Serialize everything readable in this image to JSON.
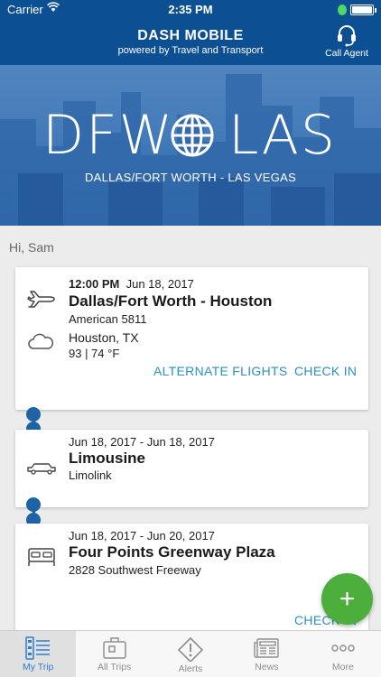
{
  "status_bar": {
    "carrier": "Carrier",
    "time": "2:35 PM"
  },
  "header": {
    "title": "DASH MOBILE",
    "subtitle": "powered by Travel and Transport",
    "call_agent_label": "Call Agent"
  },
  "hero": {
    "origin_code": "DFW",
    "destination_code": "LAS",
    "cities": "DALLAS/FORT WORTH - LAS VEGAS"
  },
  "greeting": "Hi, Sam",
  "cards": {
    "flight": {
      "time": "12:00 PM",
      "date": "Jun 18, 2017",
      "title": "Dallas/Fort Worth - Houston",
      "carrier": "American 5811",
      "weather_location": "Houston, TX",
      "weather_temps": "93 | 74 °F",
      "alternate_label": "ALTERNATE FLIGHTS",
      "checkin_label": "CHECK IN"
    },
    "limo": {
      "dates": "Jun 18, 2017 - Jun 18, 2017",
      "title": "Limousine",
      "provider": "Limolink"
    },
    "hotel": {
      "dates": "Jun 18, 2017 - Jun 20, 2017",
      "title": "Four Points Greenway Plaza",
      "address": "2828 Southwest Freeway",
      "checkin_label": "CHECK IN"
    }
  },
  "fab": {
    "icon": "plus-icon",
    "symbol": "+"
  },
  "tabs": [
    {
      "label": "My Trip",
      "icon": "my-trip-icon",
      "active": true
    },
    {
      "label": "All Trips",
      "icon": "suitcase-icon",
      "active": false
    },
    {
      "label": "Alerts",
      "icon": "alert-icon",
      "active": false
    },
    {
      "label": "News",
      "icon": "newspaper-icon",
      "active": false
    },
    {
      "label": "More",
      "icon": "more-icon",
      "active": false
    }
  ],
  "colors": {
    "brand_blue": "#0d4f93",
    "accent_link": "#2b8fbf",
    "fab_green": "#4caf3c",
    "tab_active": "#2b7fd0"
  }
}
